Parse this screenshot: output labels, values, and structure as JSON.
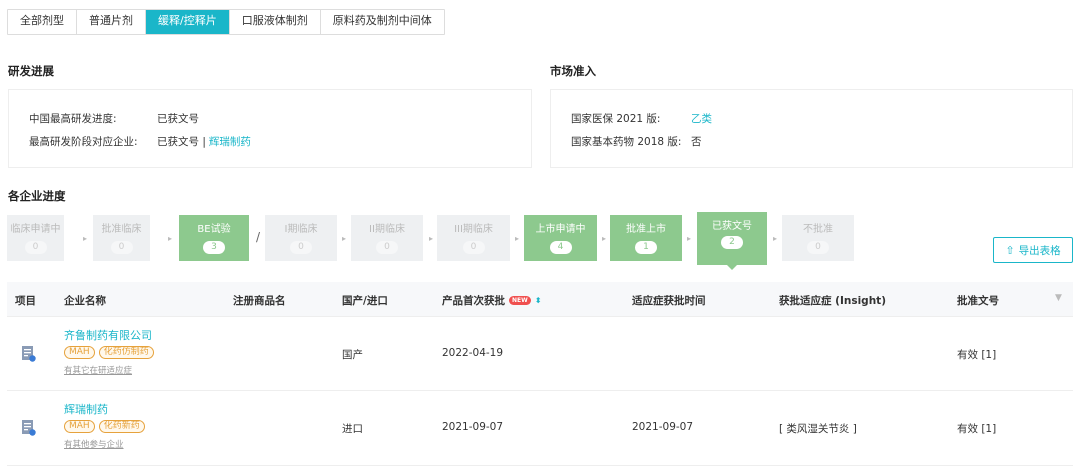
{
  "tabs": [
    "全部剂型",
    "普通片剂",
    "缓释/控释片",
    "口服液体制剂",
    "原料药及制剂中间体"
  ],
  "active_tab_index": 2,
  "rd": {
    "title": "研发进展",
    "row1_label": "中国最高研发进度:",
    "row1_value": "已获文号",
    "row2_label": "最高研发阶段对应企业:",
    "row2_value": "已获文号 |",
    "row2_link": "辉瑞制药"
  },
  "market": {
    "title": "市场准入",
    "row1_label": "国家医保 2021 版:",
    "row1_value": "乙类",
    "row2_label": "国家基本药物 2018 版:",
    "row2_value": "否"
  },
  "progress": {
    "title": "各企业进度",
    "stages": [
      {
        "label": "临床申请中",
        "count": "0",
        "state": "grey"
      },
      {
        "label": "批准临床",
        "count": "0",
        "state": "grey"
      },
      {
        "label": "BE试验",
        "count": "3",
        "state": "green"
      },
      {
        "label": "I期临床",
        "count": "0",
        "state": "grey"
      },
      {
        "label": "II期临床",
        "count": "0",
        "state": "grey"
      },
      {
        "label": "III期临床",
        "count": "0",
        "state": "grey"
      },
      {
        "label": "上市申请中",
        "count": "4",
        "state": "green"
      },
      {
        "label": "批准上市",
        "count": "1",
        "state": "green"
      },
      {
        "label": "已获文号",
        "count": "2",
        "state": "green-active"
      },
      {
        "label": "不批准",
        "count": "0",
        "state": "grey"
      }
    ],
    "slash": "/",
    "export_label": "导出表格"
  },
  "table": {
    "headers": {
      "item": "项目",
      "company": "企业名称",
      "brand": "注册商品名",
      "origin": "国产/进口",
      "first_approval": "产品首次获批",
      "new_badge": "NEW",
      "indication_time": "适应症获批时间",
      "indication": "获批适应症 (Insight)",
      "approval_no": "批准文号"
    },
    "rows": [
      {
        "company": "齐鲁制药有限公司",
        "tags": [
          "MAH",
          "化药仿制药"
        ],
        "sub": "有其它在研适应症",
        "brand": "",
        "origin": "国产",
        "first_approval": "2022-04-19",
        "indication_time": "",
        "indication": "",
        "approval_no": "有效 [1]"
      },
      {
        "company": "辉瑞制药",
        "tags": [
          "MAH",
          "化药新药"
        ],
        "sub": "有其他参与企业",
        "brand": "",
        "origin": "进口",
        "first_approval": "2021-09-07",
        "indication_time": "2021-09-07",
        "indication": "[ 类风湿关节炎 ]",
        "approval_no": "有效 [1]"
      }
    ]
  },
  "colors": {
    "accent": "#1ab6c9",
    "stage_green": "#8dc98e",
    "stage_grey": "#eef0f2",
    "tag_orange": "#e6a23c",
    "new_badge": "#f0504f"
  }
}
